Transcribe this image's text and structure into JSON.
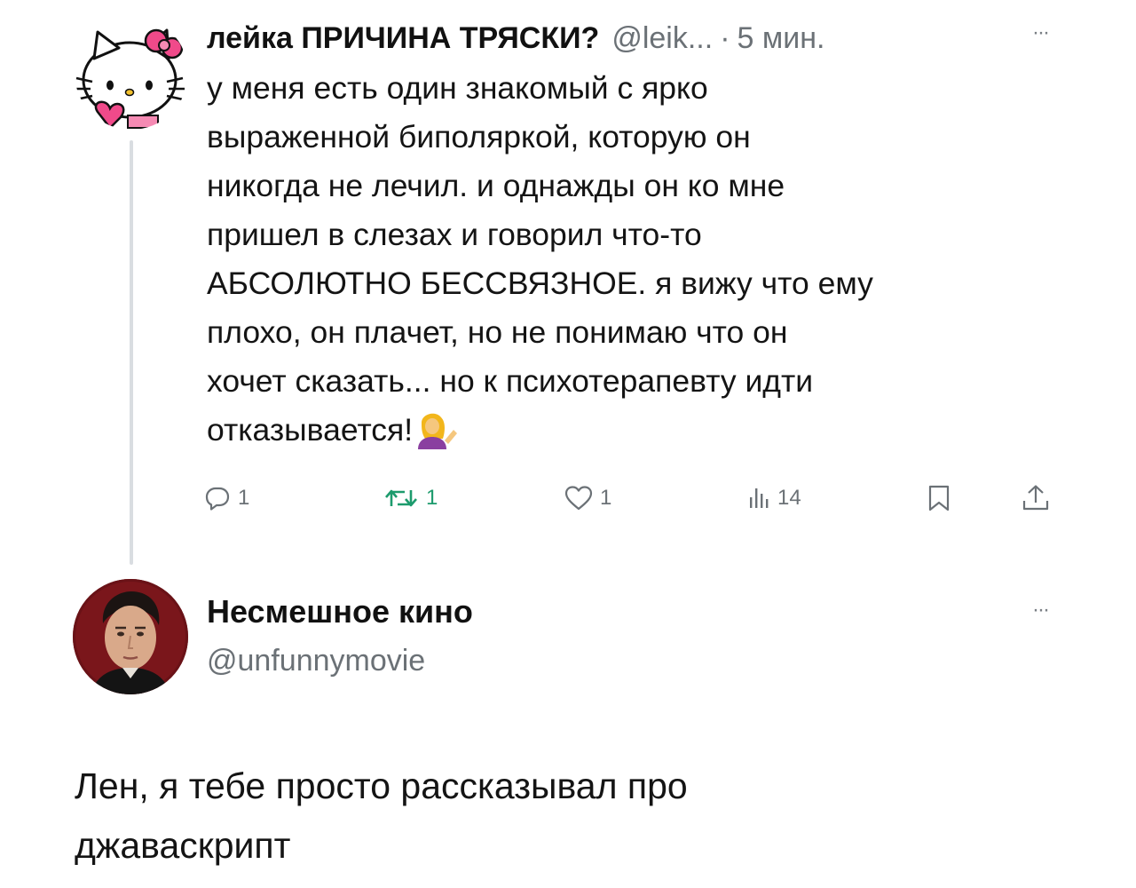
{
  "tweet1": {
    "author_name": "лейка ПРИЧИНА ТРЯСКИ?",
    "handle": "@leik...",
    "separator": "·",
    "time": "5 мин.",
    "more_label": "···",
    "avatar_icon": "hello-kitty-avatar",
    "text_lines": [
      "у меня есть один знакомый с ярко",
      "выраженной биполяркой, которую он",
      "никогда не лечил. и однажды он ко мне",
      "пришел в слезах и говорил что-то",
      "АБСОЛЮТНО БЕССВЯЗНОЕ. я вижу что ему",
      "плохо, он плачет, но не понимаю что он",
      "хочет сказать... но к психотерапевту идти",
      "отказывается!"
    ],
    "trailing_emoji": "person-tipping-hand-emoji",
    "actions": {
      "replies": "1",
      "retweets": "1",
      "likes": "1",
      "views": "14"
    },
    "colors": {
      "retweet": "#1d9b6d",
      "muted": "#6b7176"
    }
  },
  "tweet2": {
    "author_name": "Несмешное кино",
    "handle": "@unfunnymovie",
    "more_label": "···",
    "avatar_icon": "man-portrait-avatar",
    "text_lines": [
      "Лен, я тебе просто рассказывал про",
      "джаваскрипт"
    ]
  }
}
